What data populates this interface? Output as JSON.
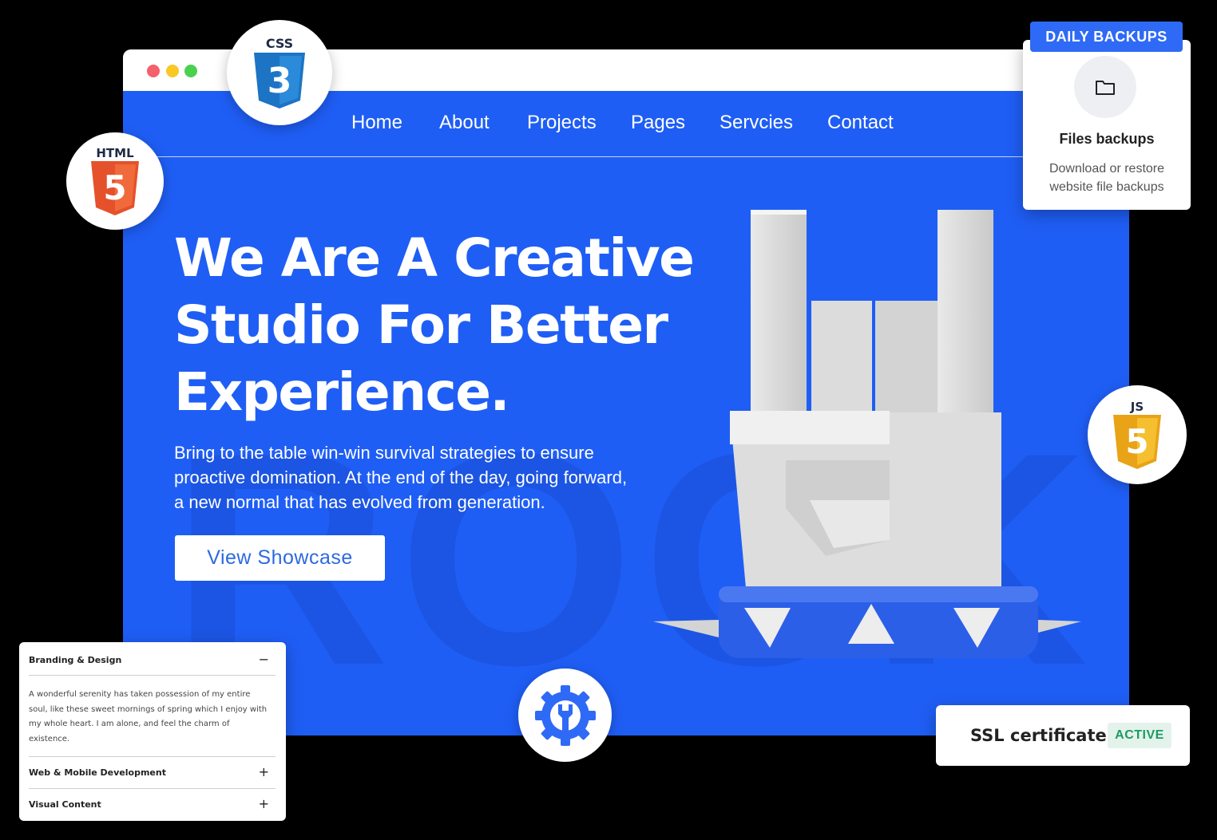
{
  "browser": {
    "nav": [
      "Home",
      "About",
      "Projects",
      "Pages",
      "Servcies",
      "Contact"
    ],
    "background_word": "ROCK"
  },
  "hero": {
    "title_lines": [
      "We Are A Creative",
      "Studio For Better",
      "Experience."
    ],
    "subtitle_lines": [
      "Bring to the table win-win survival strategies to ensure",
      "proactive domination. At the end of the day, going forward,",
      "a new normal that has evolved from generation."
    ],
    "cta_label": "View Showcase"
  },
  "badges": {
    "css_label": "CSS",
    "css_num": "3",
    "html_label": "HTML",
    "html_num": "5",
    "js_label": "JS",
    "js_num": "5"
  },
  "backup": {
    "badge": "DAILY BACKUPS",
    "title": "Files backups",
    "desc_lines": [
      "Download or restore",
      "website file backups"
    ]
  },
  "ssl": {
    "label": "SSL certificate",
    "status": "ACTIVE"
  },
  "accordion": {
    "items": [
      {
        "title": "Branding & Design",
        "toggle": "−"
      },
      {
        "title": "Web & Mobile Development",
        "toggle": "+"
      },
      {
        "title": "Visual Content",
        "toggle": "+"
      }
    ],
    "body_lines": [
      "A wonderful serenity has taken possession of my entire",
      "soul, like these sweet mornings of spring which I enjoy with",
      "my whole heart. I am alone, and feel the charm of",
      "existence."
    ]
  },
  "colors": {
    "brand_blue": "#1f5ef5",
    "css_blue": "#1d74c4",
    "html_orange": "#e5512b",
    "js_yellow": "#f0b323",
    "active_green": "#1e9a62"
  },
  "icons": [
    "css3-icon",
    "html5-icon",
    "js-icon",
    "gear-wrench-icon",
    "folder-icon"
  ]
}
